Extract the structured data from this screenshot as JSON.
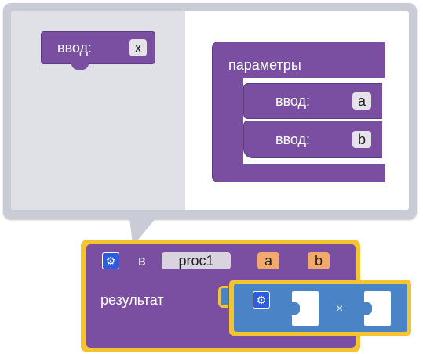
{
  "mutator": {
    "flyout_block": {
      "label": "ввод:",
      "field": "x"
    },
    "container_block": {
      "title": "параметры",
      "items": [
        {
          "label": "ввод:",
          "field": "a"
        },
        {
          "label": "ввод:",
          "field": "b"
        }
      ]
    }
  },
  "procedure": {
    "prefix": "в",
    "name": "proc1",
    "params": [
      "a",
      "b"
    ],
    "result_label": "результат",
    "operator": "×"
  },
  "colors": {
    "procedure_block": "#7a4ea0",
    "math_block": "#4b84c6",
    "selection_outline": "#f4c430",
    "param_field": "#f2a96b",
    "mutator_icon": "#2d5ddc"
  },
  "icons": {
    "mutator_gear": "gear-icon",
    "math_gear": "gear-icon"
  }
}
